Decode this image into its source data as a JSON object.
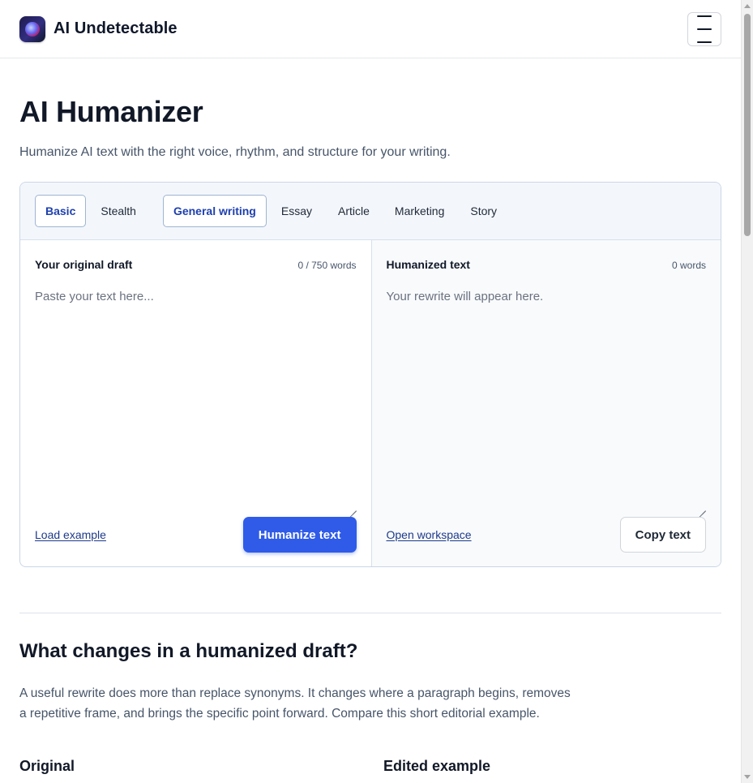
{
  "header": {
    "brand": "AI Undetectable",
    "logo_icon": "galaxy-logo-icon",
    "menu_icon": "hamburger-menu-icon"
  },
  "hero": {
    "title": "AI Humanizer",
    "subtitle": "Humanize AI text with the right voice, rhythm, and structure for your writing."
  },
  "tool": {
    "mode_tabs": [
      {
        "label": "Basic",
        "selected": true
      },
      {
        "label": "Stealth",
        "selected": false
      }
    ],
    "style_tabs": [
      {
        "label": "General writing",
        "selected": true
      },
      {
        "label": "Essay",
        "selected": false
      },
      {
        "label": "Article",
        "selected": false
      },
      {
        "label": "Marketing",
        "selected": false
      },
      {
        "label": "Story",
        "selected": false
      }
    ],
    "input": {
      "title": "Your original draft",
      "count": "0 / 750 words",
      "placeholder": "Paste your text here...",
      "example_link": "Load example",
      "submit_label": "Humanize text"
    },
    "output": {
      "title": "Humanized text",
      "count": "0 words",
      "placeholder": "Your rewrite will appear here.",
      "workspace_link": "Open workspace",
      "copy_label": "Copy text"
    }
  },
  "section": {
    "title": "What changes in a humanized draft?",
    "body": "A useful rewrite does more than replace synonyms. It changes where a paragraph begins, removes a repetitive frame, and brings the specific point forward. Compare this short editorial example.",
    "col_original": "Original",
    "col_edited": "Edited example"
  },
  "colors": {
    "accent": "#2f5be8",
    "tab_active_text": "#1e40af",
    "tab_bar_bg": "#f3f7fc"
  }
}
